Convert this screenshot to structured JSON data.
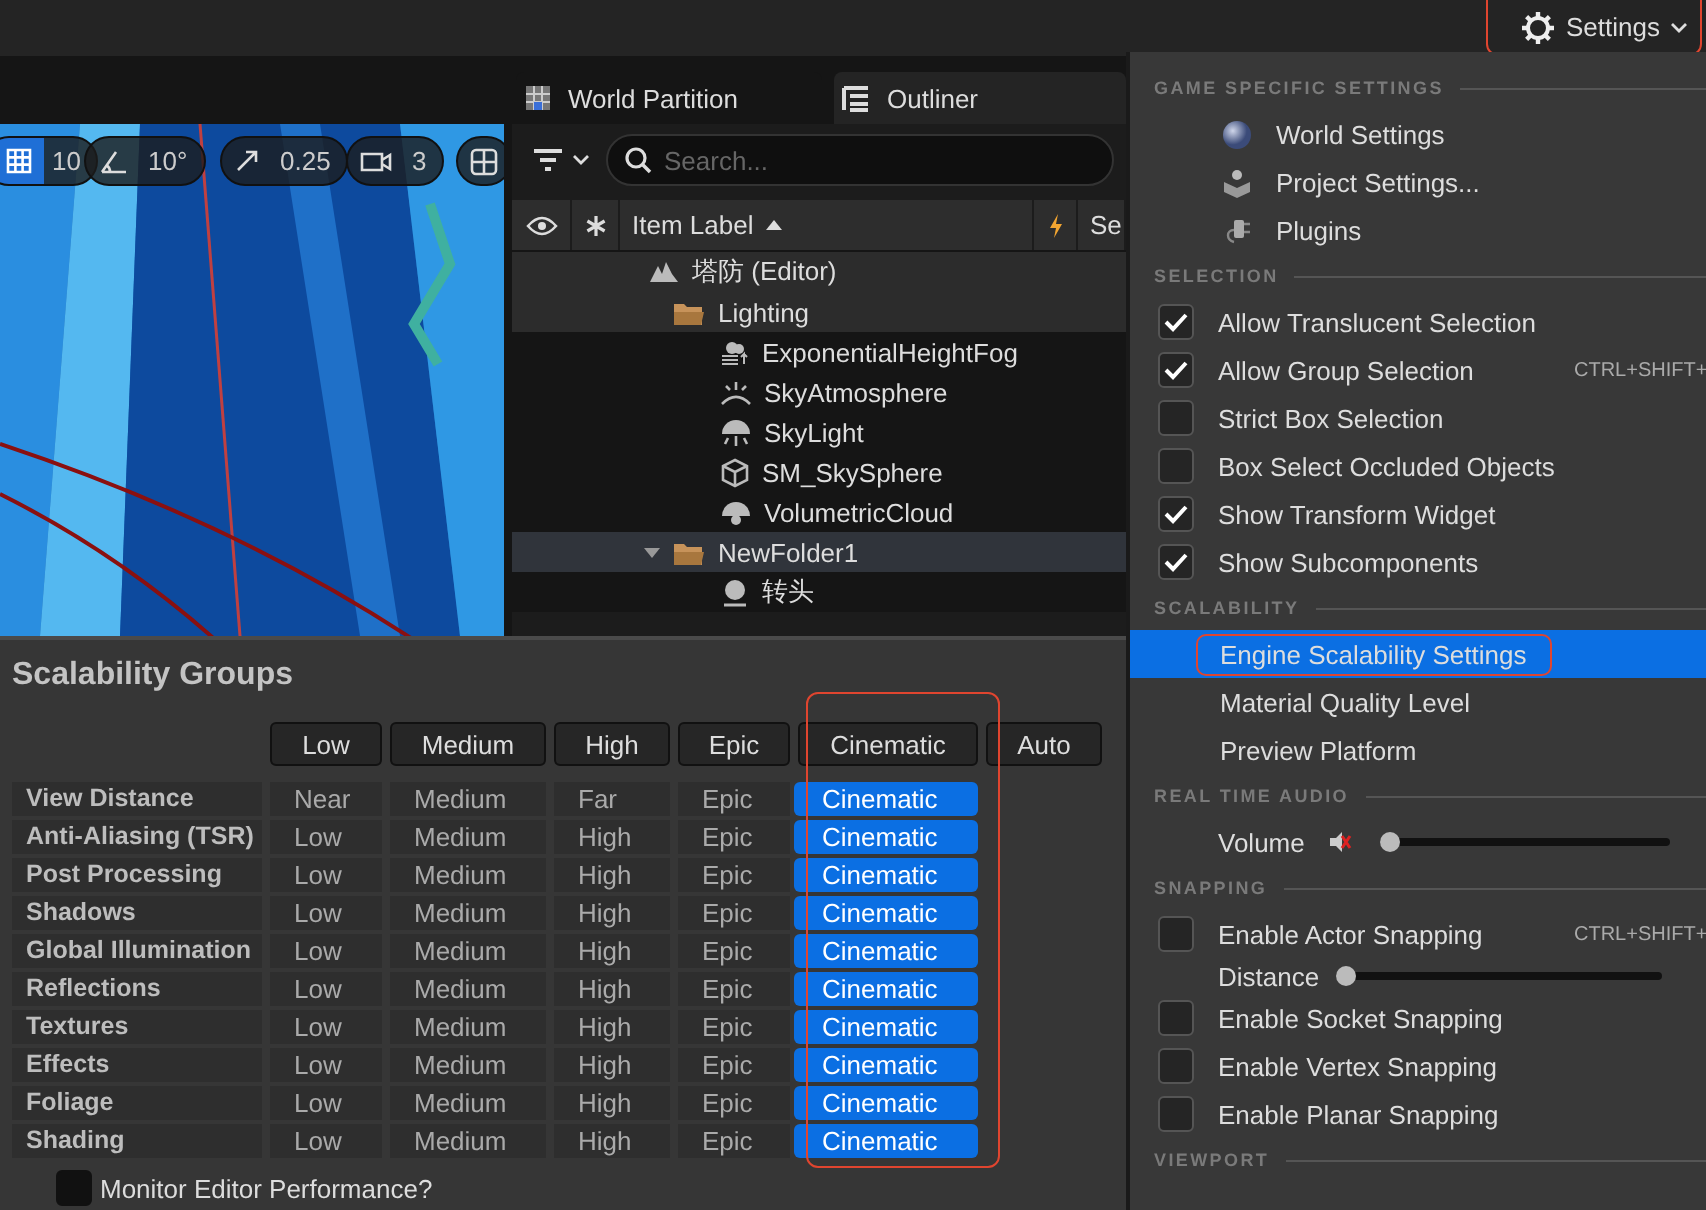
{
  "top_bar": {
    "settings_button": {
      "label": "Settings",
      "annotated": true
    }
  },
  "viewport": {
    "toolbar": [
      {
        "kind": "grid",
        "value": "10",
        "selected": true
      },
      {
        "kind": "angle",
        "value": "10°",
        "selected": false
      },
      {
        "kind": "scale",
        "value": "0.25",
        "selected": false
      },
      {
        "kind": "camera",
        "value": "3",
        "selected": false
      },
      {
        "kind": "layout",
        "selected": false
      }
    ]
  },
  "tabs": [
    {
      "kind": "partition",
      "label": "World Partition",
      "selected": false
    },
    {
      "kind": "outliner",
      "label": "Outliner",
      "selected": true
    }
  ],
  "outliner": {
    "search": {
      "placeholder": "Search..."
    },
    "columns": [
      {
        "kind": "eye"
      },
      {
        "kind": "star"
      },
      {
        "kind": "label",
        "label": "Item Label",
        "sorted": true
      },
      {
        "kind": "lightning"
      },
      {
        "kind": "text",
        "label": "Se"
      }
    ],
    "tree": [
      {
        "kind": "level",
        "label": "塔防 (Editor)",
        "selected": false,
        "children": [
          {
            "kind": "folder",
            "label": "Lighting",
            "selected": false,
            "children": [
              {
                "kind": "fog",
                "label": "ExponentialHeightFog",
                "selected": false
              },
              {
                "kind": "atmosphere",
                "label": "SkyAtmosphere",
                "selected": false
              },
              {
                "kind": "light",
                "label": "SkyLight",
                "selected": false
              },
              {
                "kind": "mesh",
                "label": "SM_SkySphere",
                "selected": false
              },
              {
                "kind": "cloud",
                "label": "VolumetricCloud",
                "selected": false
              }
            ]
          },
          {
            "kind": "folder",
            "label": "NewFolder1",
            "selected": true,
            "expanded": true,
            "children": [
              {
                "kind": "actor",
                "label": "转头",
                "selected": false
              }
            ]
          }
        ]
      }
    ]
  },
  "scalability": {
    "title": "Scalability Groups",
    "presets": [
      {
        "label": "Low"
      },
      {
        "label": "Medium"
      },
      {
        "label": "High"
      },
      {
        "label": "Epic"
      },
      {
        "label": "Cinematic",
        "annotated": true
      },
      {
        "label": "Auto"
      }
    ],
    "groups": [
      {
        "name": "View Distance",
        "options": [
          {
            "text": "Near",
            "selected": false
          },
          {
            "text": "Medium",
            "selected": false
          },
          {
            "text": "Far",
            "selected": false
          },
          {
            "text": "Epic",
            "selected": false
          },
          {
            "text": "Cinematic",
            "selected": true
          }
        ]
      },
      {
        "name": "Anti-Aliasing (TSR)",
        "options": [
          {
            "text": "Low",
            "selected": false
          },
          {
            "text": "Medium",
            "selected": false
          },
          {
            "text": "High",
            "selected": false
          },
          {
            "text": "Epic",
            "selected": false
          },
          {
            "text": "Cinematic",
            "selected": true
          }
        ]
      },
      {
        "name": "Post Processing",
        "options": [
          {
            "text": "Low",
            "selected": false
          },
          {
            "text": "Medium",
            "selected": false
          },
          {
            "text": "High",
            "selected": false
          },
          {
            "text": "Epic",
            "selected": false
          },
          {
            "text": "Cinematic",
            "selected": true
          }
        ]
      },
      {
        "name": "Shadows",
        "options": [
          {
            "text": "Low",
            "selected": false
          },
          {
            "text": "Medium",
            "selected": false
          },
          {
            "text": "High",
            "selected": false
          },
          {
            "text": "Epic",
            "selected": false
          },
          {
            "text": "Cinematic",
            "selected": true
          }
        ]
      },
      {
        "name": "Global Illumination",
        "options": [
          {
            "text": "Low",
            "selected": false
          },
          {
            "text": "Medium",
            "selected": false
          },
          {
            "text": "High",
            "selected": false
          },
          {
            "text": "Epic",
            "selected": false
          },
          {
            "text": "Cinematic",
            "selected": true
          }
        ]
      },
      {
        "name": "Reflections",
        "options": [
          {
            "text": "Low",
            "selected": false
          },
          {
            "text": "Medium",
            "selected": false
          },
          {
            "text": "High",
            "selected": false
          },
          {
            "text": "Epic",
            "selected": false
          },
          {
            "text": "Cinematic",
            "selected": true
          }
        ]
      },
      {
        "name": "Textures",
        "options": [
          {
            "text": "Low",
            "selected": false
          },
          {
            "text": "Medium",
            "selected": false
          },
          {
            "text": "High",
            "selected": false
          },
          {
            "text": "Epic",
            "selected": false
          },
          {
            "text": "Cinematic",
            "selected": true
          }
        ]
      },
      {
        "name": "Effects",
        "options": [
          {
            "text": "Low",
            "selected": false
          },
          {
            "text": "Medium",
            "selected": false
          },
          {
            "text": "High",
            "selected": false
          },
          {
            "text": "Epic",
            "selected": false
          },
          {
            "text": "Cinematic",
            "selected": true
          }
        ]
      },
      {
        "name": "Foliage",
        "options": [
          {
            "text": "Low",
            "selected": false
          },
          {
            "text": "Medium",
            "selected": false
          },
          {
            "text": "High",
            "selected": false
          },
          {
            "text": "Epic",
            "selected": false
          },
          {
            "text": "Cinematic",
            "selected": true
          }
        ]
      },
      {
        "name": "Shading",
        "options": [
          {
            "text": "Low",
            "selected": false
          },
          {
            "text": "Medium",
            "selected": false
          },
          {
            "text": "High",
            "selected": false
          },
          {
            "text": "Epic",
            "selected": false
          },
          {
            "text": "Cinematic",
            "selected": true
          }
        ]
      }
    ],
    "monitor": {
      "label": "Monitor Editor Performance?",
      "checked": false
    }
  },
  "settings_menu": {
    "sections": [
      {
        "title": "GAME SPECIFIC SETTINGS",
        "items": [
          {
            "kind": "link",
            "label": "World Settings"
          },
          {
            "kind": "link",
            "label": "Project Settings..."
          },
          {
            "kind": "link",
            "label": "Plugins"
          }
        ]
      },
      {
        "title": "SELECTION",
        "items": [
          {
            "kind": "checkbox",
            "label": "Allow Translucent Selection",
            "checked": true
          },
          {
            "kind": "checkbox",
            "label": "Allow Group Selection",
            "checked": true,
            "shortcut": "CTRL+SHIFT+"
          },
          {
            "kind": "checkbox",
            "label": "Strict Box Selection",
            "checked": false
          },
          {
            "kind": "checkbox",
            "label": "Box Select Occluded Objects",
            "checked": false
          },
          {
            "kind": "checkbox",
            "label": "Show Transform Widget",
            "checked": true
          },
          {
            "kind": "checkbox",
            "label": "Show Subcomponents",
            "checked": true
          }
        ]
      },
      {
        "title": "SCALABILITY",
        "items": [
          {
            "kind": "action",
            "label": "Engine Scalability Settings",
            "selected": true,
            "annotated": true
          },
          {
            "kind": "action",
            "label": "Material Quality Level",
            "selected": false
          },
          {
            "kind": "action",
            "label": "Preview Platform",
            "selected": false
          }
        ]
      },
      {
        "title": "REAL TIME AUDIO",
        "items": [
          {
            "kind": "slider",
            "label": "Volume",
            "muted": true,
            "level": 0.02
          }
        ]
      },
      {
        "title": "SNAPPING",
        "items": [
          {
            "kind": "checkbox",
            "label": "Enable Actor Snapping",
            "checked": false,
            "shortcut": "CTRL+SHIFT+"
          },
          {
            "kind": "slider",
            "label": "Distance",
            "level": 0.02
          },
          {
            "kind": "checkbox",
            "label": "Enable Socket Snapping",
            "checked": false
          },
          {
            "kind": "checkbox",
            "label": "Enable Vertex Snapping",
            "checked": false
          },
          {
            "kind": "checkbox",
            "label": "Enable Planar Snapping",
            "checked": false
          }
        ]
      },
      {
        "title": "VIEWPORT"
      }
    ]
  }
}
